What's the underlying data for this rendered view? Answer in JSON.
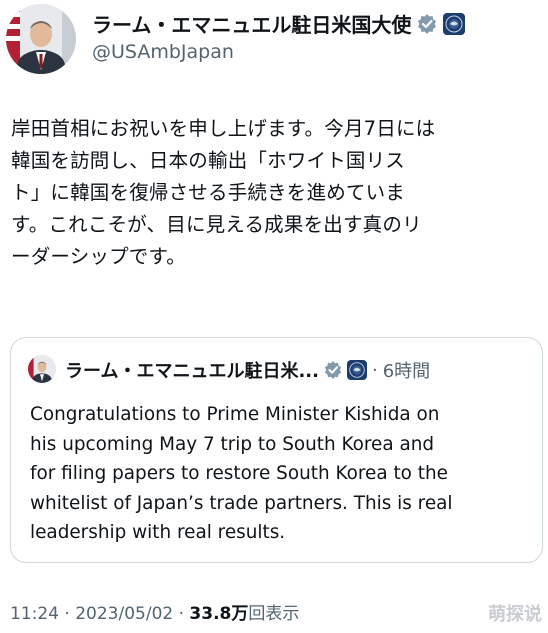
{
  "author": {
    "display_name": "ラーム・エマニュエル駐日米国大使",
    "handle": "@USAmbJapan",
    "avatar_icon": "person-portrait-icon",
    "verified_icon": "verified-badge-icon",
    "affiliation_icon": "us-seal-icon"
  },
  "tweet": {
    "lines": [
      "岸田首相にお祝いを申し上げます。今月7日には",
      "韓国を訪問し、日本の輸出「ホワイト国リス",
      "ト」に韓国を復帰させる手続きを進めていま",
      "す。これこそが、目に見える成果を出す真のリ",
      "ーダーシップです。"
    ]
  },
  "quote": {
    "display_name": "ラーム・エマニュエル駐日米...",
    "separator": "·",
    "time": "6時間",
    "lines": [
      "Congratulations to Prime Minister Kishida on",
      "his upcoming May 7 trip to South Korea and",
      "for filing papers to restore South Korea to the",
      "whitelist of Japan’s trade partners. This is real",
      "leadership with real results."
    ]
  },
  "meta": {
    "time": "11:24",
    "sep1": " · ",
    "date": "2023/05/02",
    "sep2": " · ",
    "views": "33.8万",
    "views_label": "回表示"
  },
  "watermark": "萌探说",
  "colors": {
    "text": "#0f1419",
    "secondary": "#536471",
    "verified": "#829aab",
    "border": "#cfd9de",
    "seal": "#1d3c6e"
  }
}
